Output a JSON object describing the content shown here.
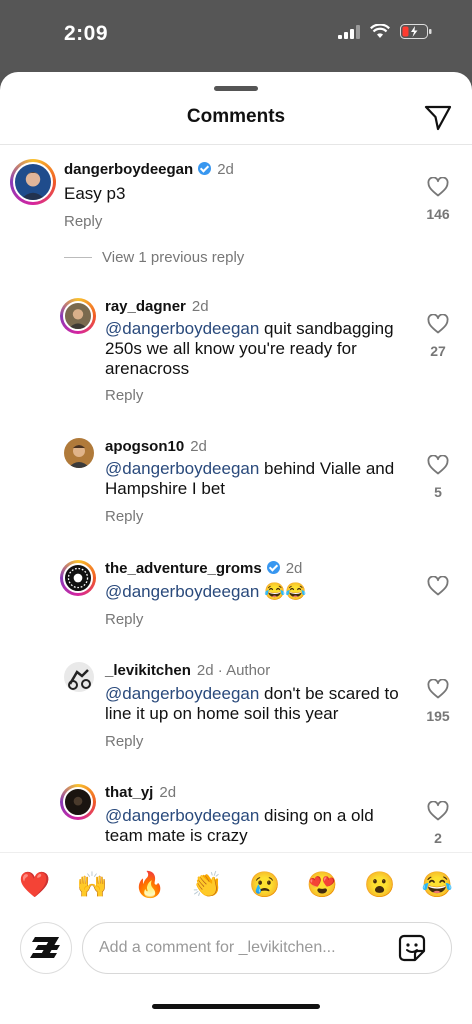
{
  "status_bar": {
    "time": "2:09"
  },
  "sheet": {
    "title": "Comments"
  },
  "thread": {
    "view_previous": "View 1 previous reply"
  },
  "comments": [
    {
      "username": "dangerboydeegan",
      "verified": true,
      "ago": "2d",
      "text": "Easy p3",
      "mention": "",
      "reply": "Reply",
      "likes": "146"
    },
    {
      "username": "ray_dagner",
      "ago": "2d",
      "mention": "@dangerboydeegan",
      "text": " quit sandbagging 250s we all know you're ready for arenacross",
      "reply": "Reply",
      "likes": "27"
    },
    {
      "username": "apogson10",
      "ago": "2d",
      "mention": "@dangerboydeegan",
      "text": " behind Vialle and Hampshire I bet",
      "reply": "Reply",
      "likes": "5"
    },
    {
      "username": "the_adventure_groms",
      "verified": true,
      "ago": "2d",
      "mention": "@dangerboydeegan",
      "text": " 😂😂",
      "reply": "Reply",
      "likes": ""
    },
    {
      "username": "_levikitchen",
      "ago": "2d · Author",
      "mention": "@dangerboydeegan",
      "text": " don't be scared to line it up on home soil this year",
      "reply": "Reply",
      "likes": "195"
    },
    {
      "username": "that_yj",
      "ago": "2d",
      "mention": "@dangerboydeegan",
      "text": " dising on a old team mate is crazy",
      "reply": "",
      "likes": "2"
    }
  ],
  "emojis": [
    "❤️",
    "🙌",
    "🔥",
    "👏",
    "😢",
    "😍",
    "😮",
    "😂"
  ],
  "composer": {
    "placeholder": "Add a comment for _levikitchen..."
  }
}
